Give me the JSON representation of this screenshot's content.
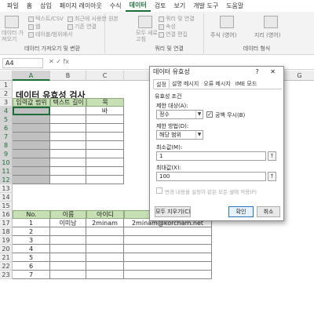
{
  "ribbon_tabs": [
    "파일",
    "홈",
    "삽입",
    "페이지 레이아웃",
    "수식",
    "데이터",
    "검토",
    "보기",
    "개발 도구",
    "도움말"
  ],
  "ribbon": {
    "get_data_big": "데이터 가져오기",
    "text_csv": "텍스트/CSV",
    "web": "웹",
    "table_range": "테이블/범위에서",
    "recent_sources": "최근에 사용한 원본",
    "existing_connections": "기존 연결",
    "group1_label": "데이터 가져오기 및 변환",
    "refresh_all": "모두 새로 고침",
    "queries_connections": "쿼리 및 연결",
    "properties": "속성",
    "edit_links": "연결 편집",
    "group2_label": "쿼리 및 연결",
    "stocks": "주식 (영어)",
    "geography": "지리 (영어)",
    "group3_label": "데이터 형식"
  },
  "formula_bar": {
    "name_box": "A4",
    "symbols": "✕  ✓  fx"
  },
  "columns": [
    "A",
    "B",
    "C",
    "D",
    "E",
    "F",
    "G"
  ],
  "rows": [
    "1",
    "2",
    "3",
    "4",
    "5",
    "6",
    "7",
    "8",
    "9",
    "10",
    "11",
    "12",
    "13",
    "14",
    "15",
    "16",
    "17",
    "18",
    "19",
    "20",
    "21",
    "22",
    "23"
  ],
  "sheet": {
    "title": "데이터 유효성 검사",
    "header_row": [
      "입력값 범위",
      "텍스트 길이",
      "목"
    ],
    "partial_c4": "바",
    "table2_header": [
      "No.",
      "이름",
      "아이디",
      "이메일"
    ],
    "table2_rows": [
      [
        "1",
        "이미남",
        "2minam",
        "2minam@korcham.net"
      ],
      [
        "2",
        "",
        "",
        ""
      ],
      [
        "3",
        "",
        "",
        ""
      ],
      [
        "4",
        "",
        "",
        ""
      ],
      [
        "5",
        "",
        "",
        ""
      ],
      [
        "6",
        "",
        "",
        ""
      ],
      [
        "7",
        "",
        "",
        ""
      ]
    ]
  },
  "dialog": {
    "title": "데이터 유효성",
    "title_icons": "?  ✕",
    "tabs": [
      "설정",
      "설명 메시지",
      "오류 메시지",
      "IME 모드"
    ],
    "section": "유효성 조건",
    "allow_label": "제한 대상(A):",
    "allow_value": "정수",
    "ignore_blank": "공백 무시(B)",
    "data_label": "제한 방법(D):",
    "data_value": "해당 범위",
    "min_label": "최소값(M):",
    "min_value": "1",
    "max_label": "최대값(X):",
    "max_value": "100",
    "apply_all": "변경 내용을 설정이 같은 모든 셀에 적용(P)",
    "clear_all": "모두 지우기(C)",
    "ok": "확인",
    "cancel": "취소"
  }
}
